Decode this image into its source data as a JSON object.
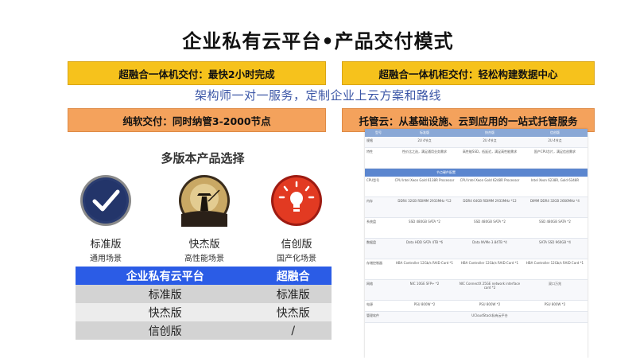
{
  "title": "企业私有云平台•产品交付模式",
  "banners": {
    "b1": "超融合一体机交付：最快2小时完成",
    "b2": "超融合一体机柜交付：轻松构建数据中心",
    "b3": "纯软交付：同时纳管3-2000节点",
    "b4": "托管云：从基础设施、云到应用的一站式托管服务"
  },
  "subtitle": "架构师一对一服务，定制企业上云方案和路线",
  "panel_title": "多版本产品选择",
  "editions": [
    {
      "name": "标准版",
      "scene": "通用场景",
      "icon": "check-icon"
    },
    {
      "name": "快杰版",
      "scene": "高性能场景",
      "icon": "moon-samurai-icon"
    },
    {
      "name": "信创版",
      "scene": "国产化场景",
      "icon": "lightbulb-icon"
    }
  ],
  "table": {
    "headers": [
      "企业私有云平台",
      "超融合"
    ],
    "rows": [
      [
        "标准版",
        "标准版"
      ],
      [
        "快杰版",
        "快杰版"
      ],
      [
        "信创版",
        "/"
      ]
    ]
  },
  "spec_sheet": {
    "headers": [
      "型号",
      "标准版",
      "快杰版",
      "信创版"
    ],
    "rows": [
      [
        "规格",
        "2U 4节点",
        "2U 4节点",
        "2U 4节点"
      ],
      [
        "特性",
        "性价比之选，满足通用业务需求",
        "高性能SSD，低延迟，满足高性能需求",
        "国产CPU芯片，满足信创需求"
      ],
      [
        "CPU型号",
        "CPU Intel Xeon Gold 6138R Processor",
        "CPU Intel Xeon Gold 6248R Processor",
        "Intel Xeon 6238R, Gold 6348R"
      ],
      [
        "内存",
        "DDR4 32GB RDIMM 2933MHz *12",
        "DDR4 64GB RDIMM 2933MHz *12",
        "DIMM DDR4 32GB 2666MHz *4"
      ],
      [
        "系统盘",
        "SSD 480GB SATA *2",
        "SSD 480GB SATA *2",
        "SSD 480GB SATA *2"
      ],
      [
        "数据盘",
        "Data HDD SATA 4TB *6",
        "Data NVMe 3.84TB *4",
        "SATA SSD 960GB *4"
      ],
      [
        "存储控制器",
        "HBA Controller 12Gb/s RAID Card *1",
        "HBA Controller 12Gb/s RAID Card *1",
        "HBA Controller 12Gb/s RAID Card *1"
      ],
      [
        "网络",
        "NIC 10GE SFP+ *2",
        "NIC ConnectX 25GE network interface card *2",
        "双口万兆"
      ],
      [
        "电源",
        "PSU 800W *2",
        "PSU 800W *2",
        "PSU 800W *2"
      ],
      [
        "管理软件",
        "",
        "UCloudStack私有云平台",
        ""
      ]
    ],
    "band": "节点硬件配置"
  },
  "colors": {
    "banner_yellow": "#f6c21c",
    "banner_orange": "#f4a25c",
    "table_header": "#2b5ce6",
    "subtitle": "#3b56a6"
  }
}
